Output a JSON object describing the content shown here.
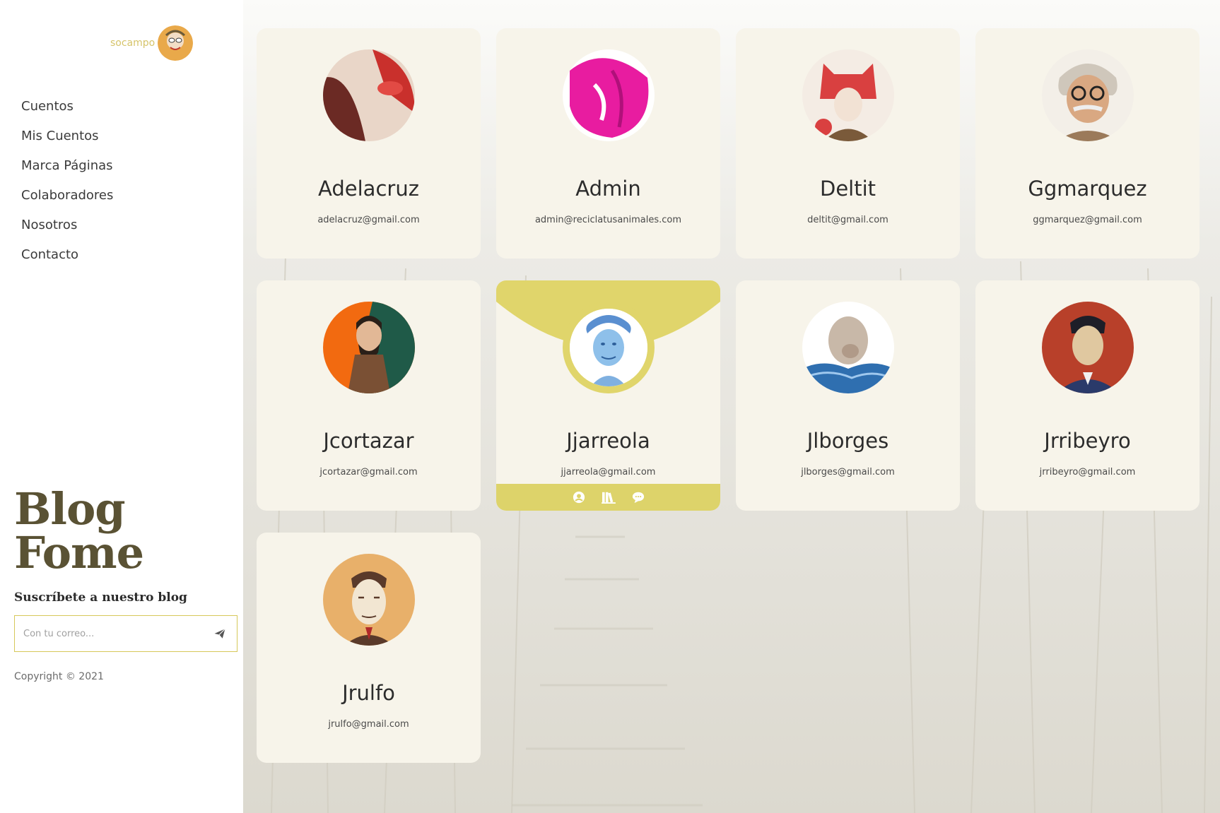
{
  "sidebar": {
    "user": {
      "name": "socampo",
      "avatar_icon": "user-avatar-icon"
    },
    "nav": [
      {
        "label": "Cuentos"
      },
      {
        "label": "Mis Cuentos"
      },
      {
        "label": "Marca Páginas"
      },
      {
        "label": "Colaboradores"
      },
      {
        "label": "Nosotros"
      },
      {
        "label": "Contacto"
      }
    ],
    "brand": {
      "line1": "Blog",
      "line2": "Fome"
    },
    "subscribe": {
      "label": "Suscríbete a nuestro blog",
      "placeholder": "Con tu correo...",
      "send_icon": "paper-plane-icon"
    },
    "copyright": "Copyright © 2021"
  },
  "authors": [
    {
      "name": "Adelacruz",
      "email": "adelacruz@gmail.com",
      "colors": [
        "#e9d6c8",
        "#c9302c",
        "#6b2a24"
      ]
    },
    {
      "name": "Admin",
      "email": "admin@reciclatusanimales.com",
      "colors": [
        "#ffffff",
        "#e81ca0",
        "#b0107a"
      ]
    },
    {
      "name": "Deltit",
      "email": "deltit@gmail.com",
      "colors": [
        "#f4ece4",
        "#d94040",
        "#7a5a3a"
      ]
    },
    {
      "name": "Ggmarquez",
      "email": "ggmarquez@gmail.com",
      "colors": [
        "#f3efe8",
        "#9b7a5a",
        "#3c3028"
      ]
    },
    {
      "name": "Jcortazar",
      "email": "jcortazar@gmail.com",
      "colors": [
        "#f26a10",
        "#1f5a48",
        "#2a1f18"
      ]
    },
    {
      "name": "Jjarreola",
      "email": "jjarreola@gmail.com",
      "colors": [
        "#ffffff",
        "#7fb0e0",
        "#2d5f9a"
      ]
    },
    {
      "name": "Jlborges",
      "email": "jlborges@gmail.com",
      "colors": [
        "#ffffff",
        "#c8b8a8",
        "#2f6fb0"
      ]
    },
    {
      "name": "Jrribeyro",
      "email": "jrribeyro@gmail.com",
      "colors": [
        "#b8402a",
        "#2a3a6a",
        "#e0c8a0"
      ]
    },
    {
      "name": "Jrulfo",
      "email": "jrulfo@gmail.com",
      "colors": [
        "#e8b06a",
        "#f2e6d2",
        "#5a3a2a"
      ]
    }
  ],
  "active_card": {
    "index": 5,
    "actions": [
      {
        "icon": "user-circle-icon"
      },
      {
        "icon": "books-icon"
      },
      {
        "icon": "comment-icon"
      }
    ],
    "accent": "#ddd36a"
  },
  "colors": {
    "card_bg": "#f7f4ea",
    "accent": "#ddd36a",
    "text": "#2c2c2c"
  }
}
